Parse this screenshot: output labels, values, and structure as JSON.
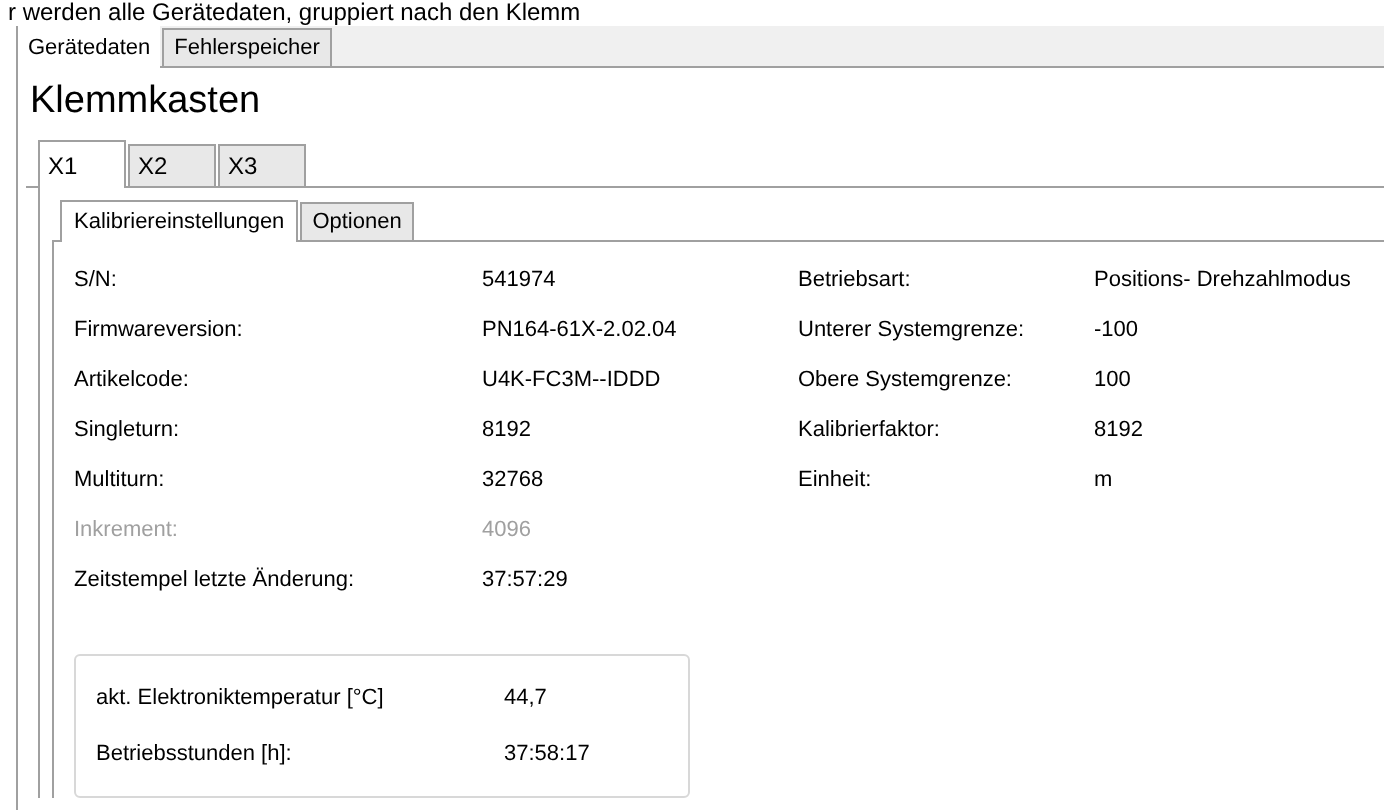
{
  "caption": "r werden alle Gerätedaten, gruppiert nach den Klemm",
  "main_tabs": [
    {
      "label": "Gerätedaten",
      "selected": true
    },
    {
      "label": "Fehlerspeicher",
      "selected": false
    }
  ],
  "heading": "Klemmkasten",
  "terminal_tabs": [
    {
      "label": "X1",
      "selected": true
    },
    {
      "label": "X2",
      "selected": false
    },
    {
      "label": "X3",
      "selected": false
    }
  ],
  "sub_tabs": [
    {
      "label": "Kalibriereinstellungen",
      "selected": true
    },
    {
      "label": "Optionen",
      "selected": false
    }
  ],
  "left_fields": [
    {
      "label": "S/N:",
      "value": "541974",
      "disabled": false
    },
    {
      "label": "Firmwareversion:",
      "value": "PN164-61X-2.02.04",
      "disabled": false
    },
    {
      "label": "Artikelcode:",
      "value": "U4K-FC3M--IDDD",
      "disabled": false
    },
    {
      "label": "Singleturn:",
      "value": "8192",
      "disabled": false
    },
    {
      "label": "Multiturn:",
      "value": "32768",
      "disabled": false
    },
    {
      "label": "Inkrement:",
      "value": "4096",
      "disabled": true
    },
    {
      "label": "Zeitstempel letzte Änderung:",
      "value": "37:57:29",
      "disabled": false
    }
  ],
  "right_fields": [
    {
      "label": "Betriebsart:",
      "value": "Positions- Drehzahlmodus"
    },
    {
      "label": "Unterer Systemgrenze:",
      "value": "-100"
    },
    {
      "label": "Obere Systemgrenze:",
      "value": "100"
    },
    {
      "label": "Kalibrierfaktor:",
      "value": "8192"
    },
    {
      "label": "Einheit:",
      "value": "m"
    }
  ],
  "status_group": [
    {
      "label": "akt. Elektroniktemperatur [°C]",
      "value": "44,7"
    },
    {
      "label": "Betriebsstunden [h]:",
      "value": "37:58:17"
    }
  ]
}
